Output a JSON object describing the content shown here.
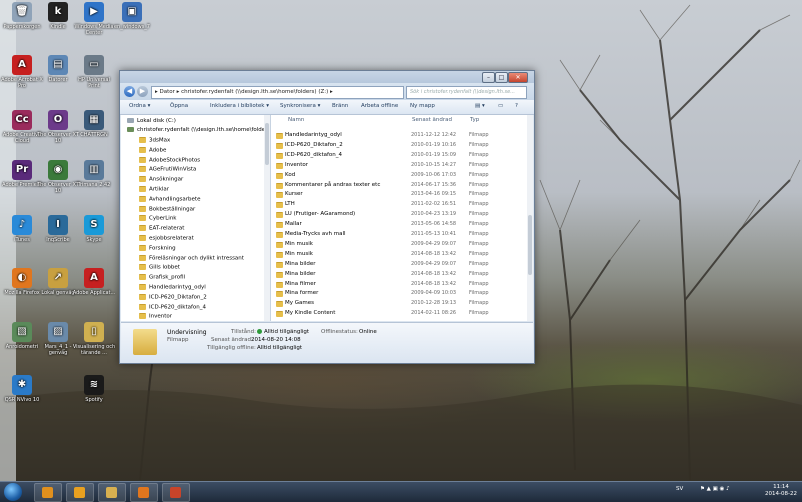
{
  "desktop": {
    "icons": [
      {
        "label": "Papperskorgen",
        "color": "#8fa3b8",
        "glyph": "🗑"
      },
      {
        "label": "Kindle",
        "color": "#222222",
        "glyph": "k"
      },
      {
        "label": "Windows Media Center",
        "color": "#2f74c8",
        "glyph": "▶"
      },
      {
        "label": "en_windows_7",
        "color": "#3a6fb8",
        "glyph": "▣"
      },
      {
        "label": "Adobe Acrobat X Pro",
        "color": "#c62020",
        "glyph": "A"
      },
      {
        "label": "Datorer",
        "color": "#5d87b5",
        "glyph": "▤"
      },
      {
        "label": "HP Universal Print",
        "color": "#6b7a88",
        "glyph": "▭"
      },
      {
        "label": "Adobe Creative Cloud",
        "color": "#9a2b5c",
        "glyph": "Cc"
      },
      {
        "label": "The Observer XT 10",
        "color": "#6c3a8a",
        "glyph": "O"
      },
      {
        "label": "CHATTRGN",
        "color": "#3a5a7a",
        "glyph": "▦"
      },
      {
        "label": "Adobe Premiere",
        "color": "#5a2a7a",
        "glyph": "Pr"
      },
      {
        "label": "The Observer XT 10",
        "color": "#3b7a3b",
        "glyph": "◉"
      },
      {
        "label": "Trimana 2.42",
        "color": "#5a7a9a",
        "glyph": "▥"
      },
      {
        "label": "iTunes",
        "color": "#2a8ad8",
        "glyph": "♪"
      },
      {
        "label": "InqScribe",
        "color": "#2a6a9a",
        "glyph": "I"
      },
      {
        "label": "Skype",
        "color": "#1a9ad8",
        "glyph": "S"
      },
      {
        "label": "Mozilla Firefox",
        "color": "#e0761e",
        "glyph": "◐"
      },
      {
        "label": "Lokal genväg",
        "color": "#c8a040",
        "glyph": "↗"
      },
      {
        "label": "Adobe Applicat...",
        "color": "#c62020",
        "glyph": "A"
      },
      {
        "label": "Anroidometri",
        "color": "#5a8a5a",
        "glyph": "▧"
      },
      {
        "label": "Mars_4_1 - genväg",
        "color": "#6a8aaa",
        "glyph": "▨"
      },
      {
        "label": "Visualisering och tärande ...",
        "color": "#d0b050",
        "glyph": "▯"
      },
      {
        "label": "QSR NVivo 10",
        "color": "#2a7ac8",
        "glyph": "✱"
      },
      {
        "label": "Spotify",
        "color": "#1a1a1a",
        "glyph": "≋"
      }
    ]
  },
  "window": {
    "address": "▸ Dator ▸ christofer.rydenfalt (\\\\design.lth.se\\home\\folders) (Z:) ▸",
    "search_placeholder": "Sök i christofer.rydenfalt (\\\\design.lth.se...",
    "toolbar": [
      "Ordna ▾",
      "Öppna",
      "Inkludera i bibliotek ▾",
      "Synkronisera ▾",
      "Bränn",
      "Arbeta offline",
      "Ny mapp"
    ],
    "nav": {
      "local_disk": "Lokal disk (C:)",
      "network_drive": "christofer.rydenfalt (\\\\design.lth.se\\home\\folders",
      "folders": [
        "3dsMax",
        "Adobe",
        "AdobeStockPhotos",
        "AGeFrutiWinVista",
        "Ansökningar",
        "Artiklar",
        "Avhandlingsarbete",
        "Bokbeställningar",
        "CyberLink",
        "EAT-relaterat",
        "esjobbsrelaterat",
        "Forskning",
        "Föreläsningar och dylikt intressant",
        "Gills lobbet",
        "Grafisk_profil",
        "Handledarintyg_odyl",
        "ICD-P620_Diktafon_2",
        "ICD-P620_diktafon_4",
        "Inventor"
      ]
    },
    "columns": {
      "name": "Namn",
      "modified": "Senast ändrad",
      "type": "Typ"
    },
    "files": [
      {
        "name": "Handledarintyg_odyl",
        "date": "2011-12-12 12:42",
        "type": "Filmapp"
      },
      {
        "name": "ICD-P620_Diktafon_2",
        "date": "2010-01-19 10:16",
        "type": "Filmapp"
      },
      {
        "name": "ICD-P620_diktafon_4",
        "date": "2010-01-19 15:09",
        "type": "Filmapp"
      },
      {
        "name": "Inventor",
        "date": "2010-10-15 14:27",
        "type": "Filmapp"
      },
      {
        "name": "Kod",
        "date": "2009-10-06 17:03",
        "type": "Filmapp"
      },
      {
        "name": "Kommentarer på andras texter etc",
        "date": "2014-06-17 15:36",
        "type": "Filmapp"
      },
      {
        "name": "Kurser",
        "date": "2013-04-16 09:15",
        "type": "Filmapp"
      },
      {
        "name": "LTH",
        "date": "2011-02-02 16:51",
        "type": "Filmapp"
      },
      {
        "name": "LU (Frutiger- AGaramond)",
        "date": "2010-04-23 13:19",
        "type": "Filmapp"
      },
      {
        "name": "Mallar",
        "date": "2013-05-06 14:58",
        "type": "Filmapp"
      },
      {
        "name": "Media-Trycks avh mall",
        "date": "2011-05-13 10:41",
        "type": "Filmapp"
      },
      {
        "name": "Min musik",
        "date": "2009-04-29 09:07",
        "type": "Filmapp"
      },
      {
        "name": "Min musik",
        "date": "2014-08-18 13:42",
        "type": "Filmapp"
      },
      {
        "name": "Mina bilder",
        "date": "2009-04-29 09:07",
        "type": "Filmapp"
      },
      {
        "name": "Mina bilder",
        "date": "2014-08-18 13:42",
        "type": "Filmapp"
      },
      {
        "name": "Mina filmer",
        "date": "2014-08-18 13:42",
        "type": "Filmapp"
      },
      {
        "name": "Mina former",
        "date": "2009-04-09 10:03",
        "type": "Filmapp"
      },
      {
        "name": "My Games",
        "date": "2010-12-28 19:13",
        "type": "Filmapp"
      },
      {
        "name": "My Kindle Content",
        "date": "2014-02-11 08:26",
        "type": "Filmapp"
      }
    ],
    "details": {
      "name": "Undervisning",
      "type": "Filmapp",
      "state_label": "Tillstånd:",
      "state_value": "Alltid tillgängligt",
      "modified_label": "Senast ändrad:",
      "modified_value": "2014-08-20 14:08",
      "offline_label": "Tillgänglig offline:",
      "offline_value": "Alltid tillgängligt",
      "offline_status_label": "Offlinestatus:",
      "offline_status_value": "Online"
    }
  },
  "taskbar": {
    "lang": "SV",
    "time": "11:14",
    "date": "2014-08-22",
    "apps": [
      {
        "name": "media-player",
        "color": "#e0901e"
      },
      {
        "name": "outlook",
        "color": "#e8a020"
      },
      {
        "name": "explorer",
        "color": "#d8b050"
      },
      {
        "name": "firefox",
        "color": "#e0761e"
      },
      {
        "name": "powerpoint",
        "color": "#c8442a"
      }
    ]
  }
}
